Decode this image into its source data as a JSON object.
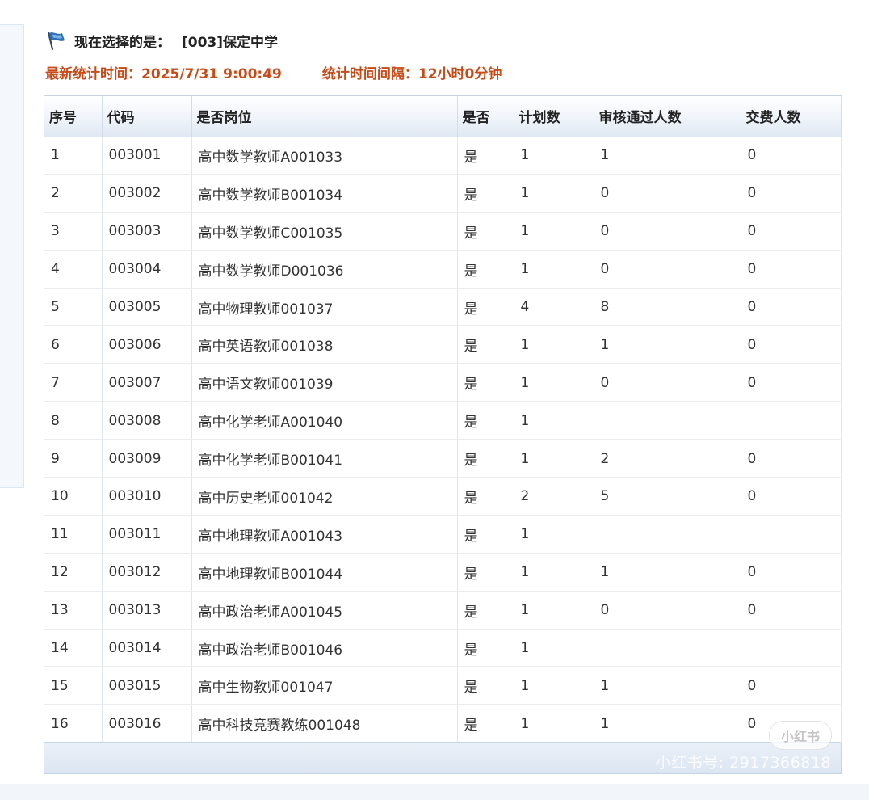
{
  "header": {
    "label": "现在选择的是：",
    "school": "[003]保定中学",
    "icon": "flag-icon"
  },
  "stats": {
    "latest_time": "最新统计时间：2025/7/31 9:00:49",
    "interval": "统计时间间隔：12小时0分钟",
    "color": "#c84a17"
  },
  "table": {
    "columns": [
      "序号",
      "代码",
      "是否岗位",
      "是否",
      "计划数",
      "审核通过人数",
      "交费人数"
    ],
    "rows": [
      [
        "1",
        "003001",
        "高中数学教师A001033",
        "是",
        "1",
        "1",
        "0"
      ],
      [
        "2",
        "003002",
        "高中数学教师B001034",
        "是",
        "1",
        "0",
        "0"
      ],
      [
        "3",
        "003003",
        "高中数学教师C001035",
        "是",
        "1",
        "0",
        "0"
      ],
      [
        "4",
        "003004",
        "高中数学教师D001036",
        "是",
        "1",
        "0",
        "0"
      ],
      [
        "5",
        "003005",
        "高中物理教师001037",
        "是",
        "4",
        "8",
        "0"
      ],
      [
        "6",
        "003006",
        "高中英语教师001038",
        "是",
        "1",
        "1",
        "0"
      ],
      [
        "7",
        "003007",
        "高中语文教师001039",
        "是",
        "1",
        "0",
        "0"
      ],
      [
        "8",
        "003008",
        "高中化学老师A001040",
        "是",
        "1",
        "",
        ""
      ],
      [
        "9",
        "003009",
        "高中化学老师B001041",
        "是",
        "1",
        "2",
        "0"
      ],
      [
        "10",
        "003010",
        "高中历史老师001042",
        "是",
        "2",
        "5",
        "0"
      ],
      [
        "11",
        "003011",
        "高中地理教师A001043",
        "是",
        "1",
        "",
        ""
      ],
      [
        "12",
        "003012",
        "高中地理教师B001044",
        "是",
        "1",
        "1",
        "0"
      ],
      [
        "13",
        "003013",
        "高中政治老师A001045",
        "是",
        "1",
        "0",
        "0"
      ],
      [
        "14",
        "003014",
        "高中政治老师B001046",
        "是",
        "1",
        "",
        ""
      ],
      [
        "15",
        "003015",
        "高中生物教师001047",
        "是",
        "1",
        "1",
        "0"
      ],
      [
        "16",
        "003016",
        "高中科技竞赛教练001048",
        "是",
        "1",
        "1",
        "0"
      ]
    ]
  },
  "watermark": {
    "badge": "小红书",
    "text": "小红书号: 2917366818"
  }
}
